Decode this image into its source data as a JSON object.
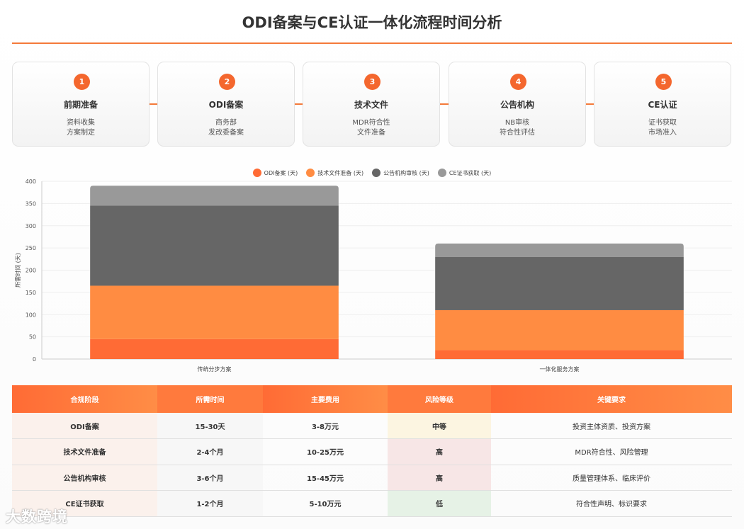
{
  "title": "ODI备案与CE认证一体化流程时间分析",
  "steps": [
    {
      "num": "1",
      "title": "前期准备",
      "desc1": "资料收集",
      "desc2": "方案制定"
    },
    {
      "num": "2",
      "title": "ODI备案",
      "desc1": "商务部",
      "desc2": "发改委备案"
    },
    {
      "num": "3",
      "title": "技术文件",
      "desc1": "MDR符合性",
      "desc2": "文件准备"
    },
    {
      "num": "4",
      "title": "公告机构",
      "desc1": "NB审核",
      "desc2": "符合性评估"
    },
    {
      "num": "5",
      "title": "CE认证",
      "desc1": "证书获取",
      "desc2": "市场准入"
    }
  ],
  "colors": {
    "accent": "#f4672e",
    "s1": "#ff6b35",
    "s2": "#ff8c42",
    "s3": "#666666",
    "s4": "#999999"
  },
  "chart_data": {
    "type": "bar",
    "stacked": true,
    "categories": [
      "传统分步方案",
      "一体化服务方案"
    ],
    "series": [
      {
        "name": "ODI备案 (天)",
        "values": [
          45,
          20
        ]
      },
      {
        "name": "技术文件准备 (天)",
        "values": [
          120,
          90
        ]
      },
      {
        "name": "公告机构审核 (天)",
        "values": [
          180,
          120
        ]
      },
      {
        "name": "CE证书获取 (天)",
        "values": [
          45,
          30
        ]
      }
    ],
    "ylabel": "所需时间 (天)",
    "ylim": [
      0,
      400
    ],
    "yticks": [
      "0",
      "50",
      "100",
      "150",
      "200",
      "250",
      "300",
      "350",
      "400"
    ],
    "legend_position": "top",
    "grid": true
  },
  "table": {
    "headers": [
      "合规阶段",
      "所需时间",
      "主要费用",
      "风险等级",
      "关键要求"
    ],
    "rows": [
      {
        "stage": "ODI备案",
        "time": "15-30天",
        "cost": "3-8万元",
        "risk": "中等",
        "risk_level": "mid",
        "key": "投资主体资质、投资方案"
      },
      {
        "stage": "技术文件准备",
        "time": "2-4个月",
        "cost": "10-25万元",
        "risk": "高",
        "risk_level": "high",
        "key": "MDR符合性、风险管理"
      },
      {
        "stage": "公告机构审核",
        "time": "3-6个月",
        "cost": "15-45万元",
        "risk": "高",
        "risk_level": "high",
        "key": "质量管理体系、临床评价"
      },
      {
        "stage": "CE证书获取",
        "time": "1-2个月",
        "cost": "5-10万元",
        "risk": "低",
        "risk_level": "low",
        "key": "符合性声明、标识要求"
      }
    ]
  },
  "watermark": "大数跨境"
}
